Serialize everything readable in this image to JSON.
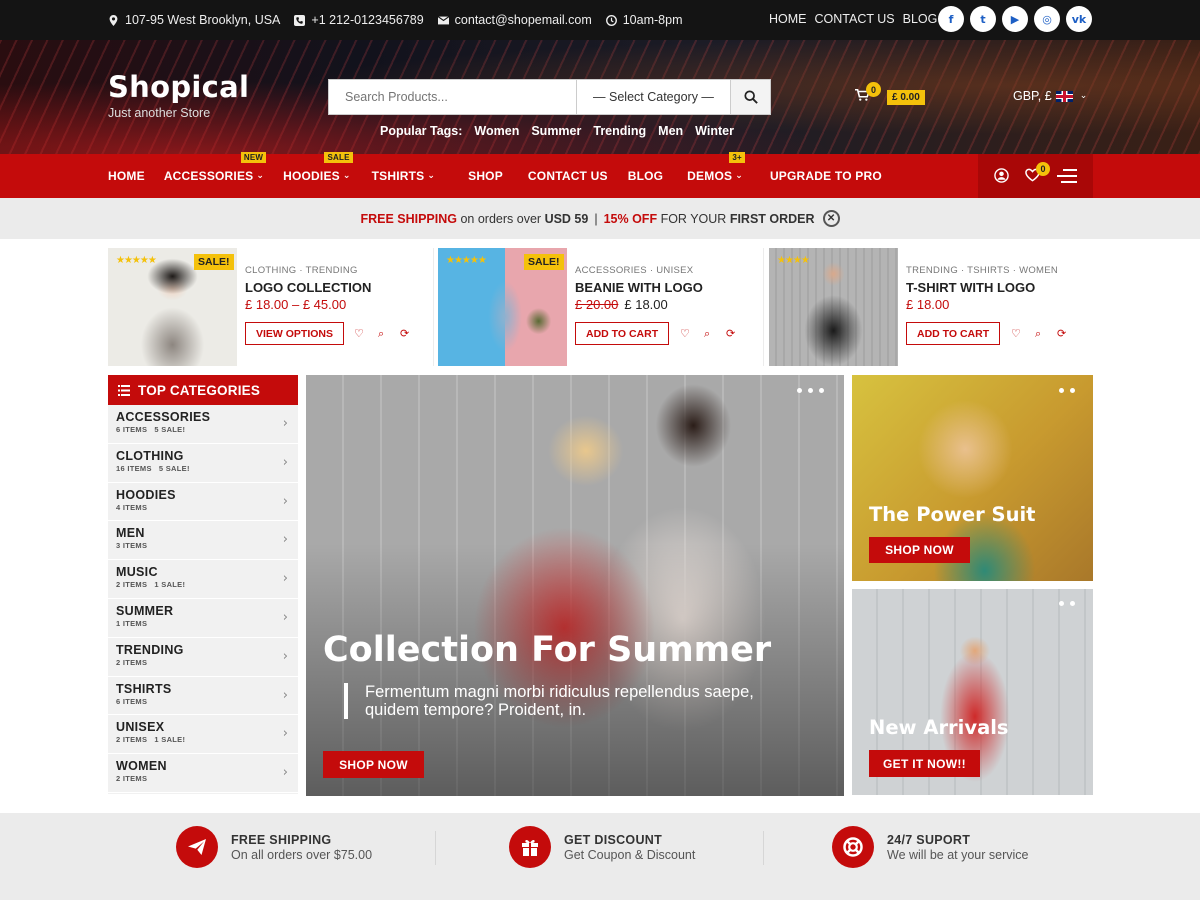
{
  "topbar": {
    "address": "107-95 West Brooklyn, USA",
    "phone": "+1 212-0123456789",
    "email": "contact@shopemail.com",
    "hours": "10am-8pm",
    "links": [
      "HOME",
      "CONTACT US",
      "BLOG"
    ],
    "socials": [
      {
        "name": "facebook-icon",
        "glyph": "f"
      },
      {
        "name": "twitter-icon",
        "glyph": "t"
      },
      {
        "name": "youtube-icon",
        "glyph": "▶"
      },
      {
        "name": "instagram-icon",
        "glyph": "◎"
      },
      {
        "name": "vk-icon",
        "glyph": "vk"
      }
    ]
  },
  "header": {
    "logo": "Shopical",
    "tagline": "Just another Store",
    "search_placeholder": "Search Products...",
    "category_select": "— Select Category —",
    "popular_tags_label": "Popular Tags:",
    "popular_tags": [
      "Women",
      "Summer",
      "Trending",
      "Men",
      "Winter"
    ],
    "cart_count": "0",
    "cart_total": "£ 0.00",
    "currency": "GBP, £"
  },
  "nav": {
    "items": [
      {
        "label": "HOME",
        "dropdown": false,
        "badge": ""
      },
      {
        "label": "ACCESSORIES",
        "dropdown": true,
        "badge": "NEW"
      },
      {
        "label": "HOODIES",
        "dropdown": true,
        "badge": "SALE"
      },
      {
        "label": "TSHIRTS",
        "dropdown": true,
        "badge": ""
      },
      {
        "label": "SHOP",
        "dropdown": false,
        "badge": ""
      },
      {
        "label": "CONTACT US",
        "dropdown": false,
        "badge": ""
      },
      {
        "label": "BLOG",
        "dropdown": false,
        "badge": ""
      },
      {
        "label": "DEMOS",
        "dropdown": true,
        "badge": "3+"
      },
      {
        "label": "UPGRADE TO PRO",
        "dropdown": false,
        "badge": ""
      }
    ],
    "wishlist_count": "0"
  },
  "promo": {
    "free_shipping": "FREE SHIPPING",
    "on_orders": "on orders over",
    "threshold": "USD 59",
    "separator": "|",
    "discount": "15% OFF",
    "for_your": "FOR YOUR",
    "first_order": "FIRST ORDER"
  },
  "products": [
    {
      "categories": "CLOTHING · TRENDING",
      "title": "LOGO COLLECTION",
      "price": "£ 18.00 – £ 45.00",
      "old_price": "",
      "new_price": "",
      "sale": "SALE!",
      "cta": "VIEW OPTIONS",
      "rating": 5
    },
    {
      "categories": "ACCESSORIES · UNISEX",
      "title": "BEANIE WITH LOGO",
      "price": "",
      "old_price": "£ 20.00",
      "new_price": "£ 18.00",
      "sale": "SALE!",
      "cta": "ADD TO CART",
      "rating": 5
    },
    {
      "categories": "TRENDING · TSHIRTS · WOMEN",
      "title": "T-SHIRT WITH LOGO",
      "price": "£ 18.00",
      "old_price": "",
      "new_price": "",
      "sale": "",
      "cta": "ADD TO CART",
      "rating": 4
    }
  ],
  "categories": {
    "title": "TOP CATEGORIES",
    "items": [
      {
        "name": "ACCESSORIES",
        "meta": "6 ITEMS   5 SALE!"
      },
      {
        "name": "CLOTHING",
        "meta": "16 ITEMS   5 SALE!"
      },
      {
        "name": "HOODIES",
        "meta": "4 ITEMS"
      },
      {
        "name": "MEN",
        "meta": "3 ITEMS"
      },
      {
        "name": "MUSIC",
        "meta": "2 ITEMS   1 SALE!"
      },
      {
        "name": "SUMMER",
        "meta": "1 ITEMS"
      },
      {
        "name": "TRENDING",
        "meta": "2 ITEMS"
      },
      {
        "name": "TSHIRTS",
        "meta": "6 ITEMS"
      },
      {
        "name": "UNISEX",
        "meta": "2 ITEMS   1 SALE!"
      },
      {
        "name": "WOMEN",
        "meta": "2 ITEMS"
      }
    ]
  },
  "hero": {
    "title": "Collection For Summer",
    "description": "Fermentum magni morbi ridiculus repellendus saepe, quidem tempore? Proident, in.",
    "button": "SHOP NOW"
  },
  "banners": [
    {
      "title": "The Power Suit",
      "button": "SHOP NOW"
    },
    {
      "title": "New Arrivals",
      "button": "GET IT NOW!!"
    }
  ],
  "features": [
    {
      "title": "FREE SHIPPING",
      "subtitle": "On all orders over $75.00",
      "icon": "paper-plane-icon"
    },
    {
      "title": "GET DISCOUNT",
      "subtitle": "Get Coupon & Discount",
      "icon": "gift-icon"
    },
    {
      "title": "24/7 SUPORT",
      "subtitle": "We will be at your service",
      "icon": "lifebuoy-icon"
    }
  ],
  "colors": {
    "accent": "#c40b0b",
    "badge": "#f4c10b",
    "topbar": "#141414"
  }
}
